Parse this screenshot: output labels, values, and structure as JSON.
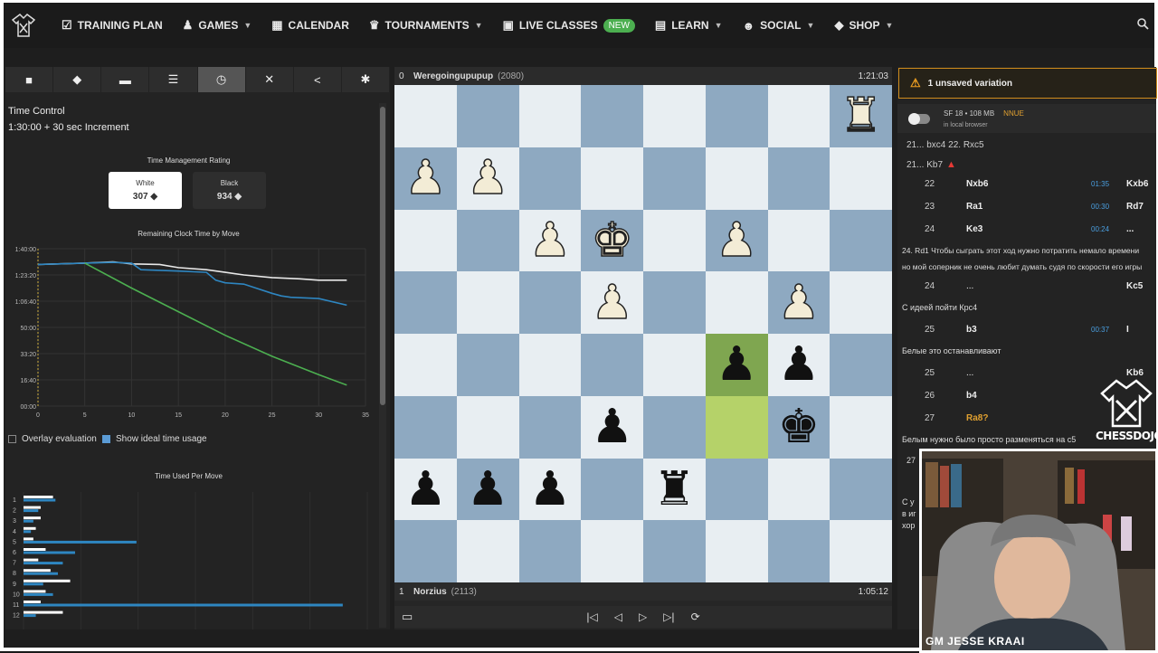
{
  "nav": {
    "items": [
      {
        "label": "TRAINING PLAN",
        "icon": "checklist-icon",
        "chevron": false
      },
      {
        "label": "GAMES",
        "icon": "pawn-icon",
        "chevron": true
      },
      {
        "label": "CALENDAR",
        "icon": "calendar-icon",
        "chevron": false
      },
      {
        "label": "TOURNAMENTS",
        "icon": "trophy-icon",
        "chevron": true
      },
      {
        "label": "LIVE CLASSES",
        "icon": "presentation-icon",
        "chevron": false,
        "badge": "NEW"
      },
      {
        "label": "LEARN",
        "icon": "book-icon",
        "chevron": true
      },
      {
        "label": "SOCIAL",
        "icon": "people-icon",
        "chevron": true
      },
      {
        "label": "SHOP",
        "icon": "tag-icon",
        "chevron": true
      }
    ]
  },
  "left": {
    "toolbar": [
      "folder-icon",
      "tag-icon",
      "comment-icon",
      "list-icon",
      "clock-icon",
      "tools-icon",
      "share-icon",
      "gear-icon"
    ],
    "active_tool": 4,
    "time_control_title": "Time Control",
    "time_control_value": "1:30:00 + 30 sec Increment",
    "tmr_title": "Time Management Rating",
    "white_label": "White",
    "white_rating": "307",
    "black_label": "Black",
    "black_rating": "934",
    "clock_chart_title": "Remaining Clock Time by Move",
    "overlay_label": "Overlay evaluation",
    "ideal_label": "Show ideal time usage",
    "time_used_title": "Time Used Per Move"
  },
  "chart_data": [
    {
      "type": "line",
      "title": "Remaining Clock Time by Move",
      "x_ticks": [
        "0",
        "5",
        "10",
        "15",
        "20",
        "25",
        "30",
        "35"
      ],
      "y_ticks": [
        "00:00",
        "16:40",
        "33:20",
        "50:00",
        "1:06:40",
        "1:23:20",
        "1:40:00"
      ],
      "xlim": [
        0,
        35
      ],
      "ylim_seconds": [
        0,
        6000
      ],
      "series": [
        {
          "color": "#e8e8e8",
          "x": [
            0,
            5,
            8,
            10,
            13,
            15,
            18,
            20,
            22,
            25,
            28,
            30,
            33
          ],
          "y": [
            5400,
            5450,
            5500,
            5420,
            5400,
            5280,
            5200,
            5100,
            5000,
            4900,
            4850,
            4800,
            4800
          ]
        },
        {
          "color": "#2e86c1",
          "x": [
            0,
            5,
            8,
            10,
            11,
            15,
            18,
            19,
            20,
            22,
            25,
            26,
            27,
            30,
            33
          ],
          "y": [
            5400,
            5450,
            5480,
            5450,
            5200,
            5150,
            5100,
            4800,
            4700,
            4650,
            4300,
            4200,
            4150,
            4100,
            3850
          ]
        },
        {
          "color": "#4caf50",
          "x": [
            5,
            10,
            15,
            20,
            25,
            30,
            33
          ],
          "y": [
            5450,
            4500,
            3600,
            2700,
            1900,
            1200,
            800
          ]
        }
      ]
    },
    {
      "type": "bar",
      "title": "Time Used Per Move",
      "categories": [
        "1",
        "2",
        "3",
        "4",
        "5",
        "6",
        "7",
        "8",
        "9",
        "10",
        "11",
        "12"
      ],
      "series": [
        {
          "color": "#ffffff",
          "values": [
            1.2,
            0.7,
            0.7,
            0.5,
            0.4,
            0.9,
            0.6,
            1.1,
            1.9,
            0.9,
            0.7,
            1.6
          ]
        },
        {
          "color": "#2e86c1",
          "values": [
            1.3,
            0.6,
            0.4,
            0.3,
            4.6,
            2.1,
            1.6,
            1.4,
            0.8,
            1.2,
            13.0,
            0.5
          ]
        }
      ]
    }
  ],
  "board": {
    "top_player": {
      "num": "0",
      "name": "Weregoingupupup",
      "rating": "(2080)",
      "clock": "1:21:03"
    },
    "bottom_player": {
      "num": "1",
      "name": "Norzius",
      "rating": "(2113)",
      "clock": "1:05:12"
    },
    "ranks": [
      [
        "",
        "",
        "",
        "",
        "",
        "",
        "",
        "wR"
      ],
      [
        "wP",
        "wP",
        "",
        "",
        "",
        "",
        "",
        ""
      ],
      [
        "",
        "",
        "wP",
        "wK",
        "",
        "wP",
        "",
        ""
      ],
      [
        "",
        "",
        "",
        "wP",
        "",
        "",
        "wP",
        ""
      ],
      [
        "",
        "",
        "",
        "",
        "",
        "bP",
        "bP",
        ""
      ],
      [
        "",
        "",
        "",
        "bP",
        "",
        "",
        "bK",
        ""
      ],
      [
        "bP",
        "bP",
        "bP",
        "",
        "bR",
        "",
        "",
        ""
      ],
      [
        "",
        "",
        "",
        "",
        "",
        "",
        "",
        ""
      ]
    ],
    "highlight_dark": [
      4,
      5
    ],
    "highlight_light": [
      5,
      5
    ],
    "controls": [
      "first-icon",
      "prev-icon",
      "next-icon",
      "last-icon",
      "flip-icon"
    ]
  },
  "right": {
    "unsaved": "1 unsaved variation",
    "engine": "SF 18 • 108 MB",
    "nnue": "NNUE",
    "engine_sub": "in local browser",
    "line1": "21... bxc4  22. Rxc5",
    "line2": "21... Kb7",
    "moves": [
      {
        "n": "22",
        "w": "Nxb6",
        "t": "01:35",
        "b": "Kxb6"
      },
      {
        "n": "23",
        "w": "Ra1",
        "t": "00:30",
        "b": "Rd7"
      },
      {
        "n": "24",
        "w": "Ke3",
        "t": "00:24",
        "b": "..."
      }
    ],
    "comment1a": "24. Rd1  Чтобы сыграть этот ход нужно потратить немало времени",
    "comment1b": "но мой соперник не очень любит думать судя по скорости его игры",
    "move24b": {
      "n": "24",
      "w": "...",
      "t": "",
      "b": "Kc5"
    },
    "comment2": "С идеей пойти Крс4",
    "move25": {
      "n": "25",
      "w": "b3",
      "t": "00:37",
      "b": ""
    },
    "comment3": "Белые это останавливают",
    "move25b": {
      "n": "25",
      "w": "...",
      "t": "",
      "b": "Kb6"
    },
    "move26": {
      "n": "26",
      "w": "b4",
      "t": "",
      "b": ""
    },
    "move27": {
      "n": "27",
      "w": "Ra8?",
      "t": "",
      "b": ""
    },
    "comment4": "Белым нужно было просто разменяться на c5",
    "move27b": "27",
    "stub1": "С у",
    "stub2": "в иг",
    "stub3": "хор"
  },
  "watermark": "CHESSDOJO",
  "webcam_name": "GM JESSE KRAAI"
}
